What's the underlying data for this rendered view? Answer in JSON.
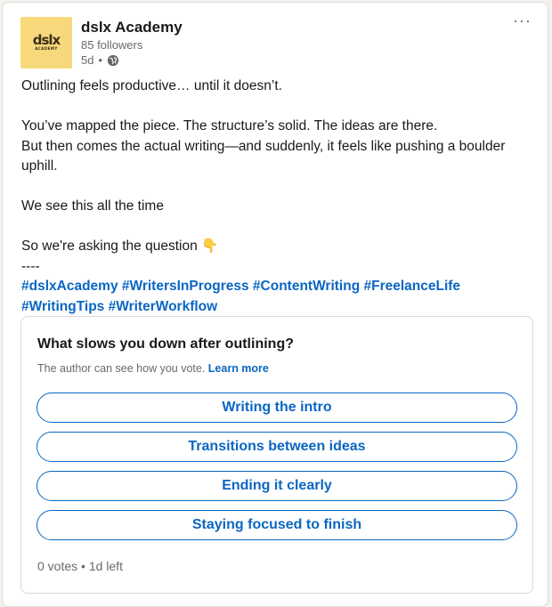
{
  "author": {
    "name": "dslx Academy",
    "logo_text": "dslx",
    "logo_subtext": "ACADEMY",
    "followers": "85 followers",
    "time": "5d",
    "separator": "•",
    "visibility_icon": "globe-icon"
  },
  "menu": {
    "more_label": "···"
  },
  "post": {
    "line1": "Outlining feels productive… until it doesn’t.",
    "line2": "You’ve mapped the piece. The structure’s solid. The ideas are there.",
    "line3": "But then comes the actual writing—and suddenly, it feels like pushing a boulder uphill.",
    "line4": "We see this all the time",
    "line5": "So we're asking the question 👇",
    "divider": "----",
    "hashtags": [
      "#dslxAcademy",
      "#WritersInProgress",
      "#ContentWriting",
      "#FreelanceLife",
      "#WritingTips",
      "#WriterWorkflow"
    ]
  },
  "poll": {
    "question": "What slows you down after outlining?",
    "note": "The author can see how you vote.",
    "learn_more": "Learn more",
    "options": [
      "Writing the intro",
      "Transitions between ideas",
      "Ending it clearly",
      "Staying focused to finish"
    ],
    "votes": "0 votes",
    "separator": "•",
    "time_left": "1d left"
  },
  "colors": {
    "accent": "#0a66c2",
    "logo_bg": "#f7d97c",
    "card_bg": "#ffffff",
    "page_bg": "#f4f2ee"
  }
}
